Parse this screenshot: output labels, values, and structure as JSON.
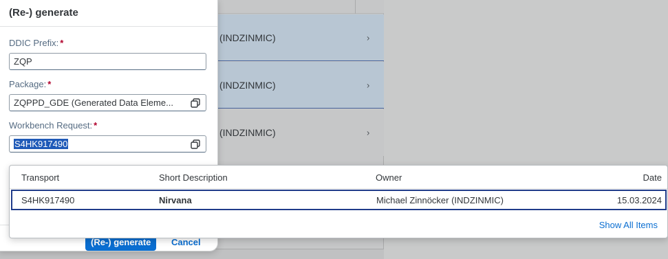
{
  "background": {
    "rows": [
      {
        "owner_id": "(INDZINMIC)"
      },
      {
        "owner_id": "(INDZINMIC)"
      },
      {
        "owner_id": "(INDZINMIC)"
      }
    ]
  },
  "dialog": {
    "title": "(Re-) generate",
    "fields": {
      "ddic_prefix": {
        "label": "DDIC Prefix:",
        "required_mark": "*",
        "value": "ZQP"
      },
      "package": {
        "label": "Package:",
        "required_mark": "*",
        "value": "ZQPPD_GDE (Generated Data Eleme..."
      },
      "workbench_request": {
        "label": "Workbench Request:",
        "required_mark": "*",
        "value": "S4HK917490"
      }
    },
    "buttons": {
      "primary": "(Re-) generate",
      "cancel": "Cancel"
    }
  },
  "value_help": {
    "columns": [
      "Transport",
      "Short Description",
      "Owner",
      "Date"
    ],
    "rows": [
      {
        "transport": "S4HK917490",
        "short_description": "Nirvana",
        "owner": "Michael Zinnöcker (INDZINMIC)",
        "date": "15.03.2024"
      }
    ],
    "show_all": "Show All Items"
  },
  "colors": {
    "accent": "#0a6ed1",
    "selection": "#1f5ab8",
    "required": "#b0002b"
  }
}
